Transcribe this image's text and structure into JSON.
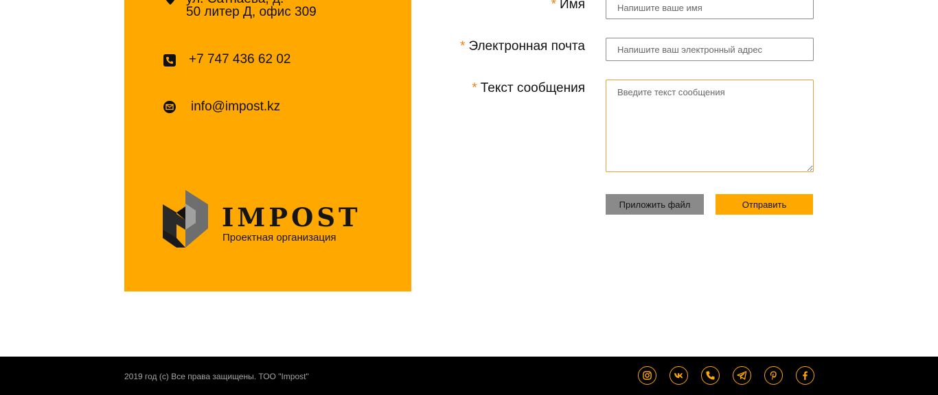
{
  "contacts": {
    "address_partial": "ул. Сатпаева, д.",
    "address_line2": "50 литер Д, офис 309",
    "phone": "+7 747 436 62 02",
    "email": "info@impost.kz"
  },
  "logo": {
    "name": "IMPOST",
    "tagline": "Проектная организация"
  },
  "form": {
    "required_mark": "*",
    "name_label": "Имя",
    "name_placeholder": "Напишите ваше имя",
    "email_label": "Электронная почта",
    "email_placeholder": "Напишите ваш электронный адрес",
    "message_label": "Текст сообщения",
    "message_placeholder": "Введите текст сообщения",
    "attach_button": "Приложить файл",
    "send_button": "Отправить"
  },
  "footer": {
    "copyright": "2019 год (c) Все права защищены. ТОО \"Impost\"",
    "social": [
      "instagram-icon",
      "vk-icon",
      "phone-icon",
      "telegram-icon",
      "pinterest-icon",
      "facebook-icon"
    ]
  },
  "colors": {
    "accent": "#FFA800",
    "required": "#F57F17",
    "button_gray": "#8a8a8a",
    "footer_bg": "#000000"
  }
}
